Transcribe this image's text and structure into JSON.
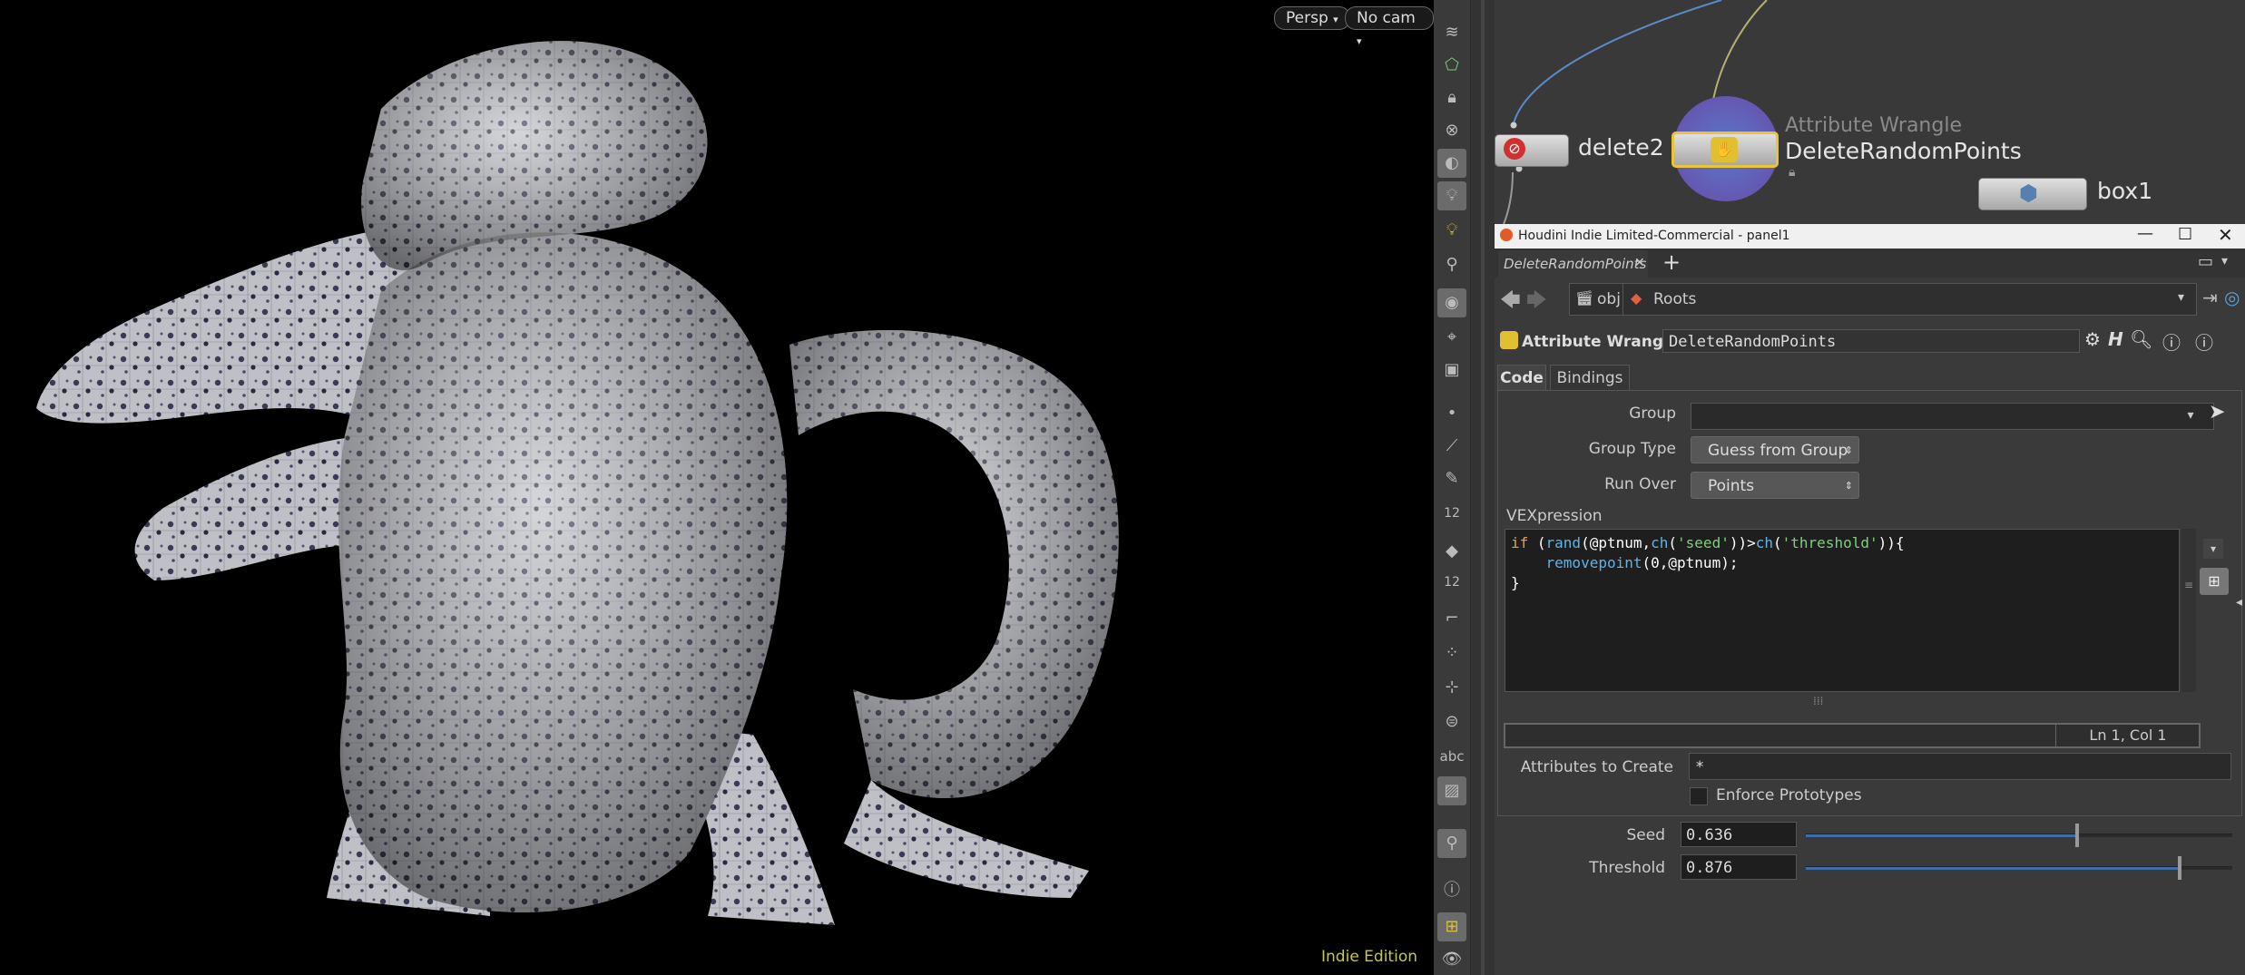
{
  "viewport": {
    "persp_label": "Persp",
    "cam_label": "No cam",
    "watermark": "Indie Edition"
  },
  "toolbar": {
    "label_12a": "12",
    "label_12b": "12",
    "label_abc": "abc"
  },
  "network": {
    "nodes": [
      {
        "name": "delete2"
      },
      {
        "type": "Attribute Wrangle",
        "name": "DeleteRandomPoints"
      },
      {
        "name": "box1"
      }
    ]
  },
  "window": {
    "title": "Houdini Indie Limited-Commercial - panel1"
  },
  "panel": {
    "tab_label": "DeleteRandomPoints",
    "path": {
      "obj": "obj",
      "roots": "Roots"
    },
    "node_type": "Attribute Wrangle",
    "node_name": "DeleteRandomPoints",
    "tabs": [
      {
        "label": "Code"
      },
      {
        "label": "Bindings"
      }
    ],
    "group_label": "Group",
    "group_value": "",
    "group_type_label": "Group Type",
    "group_type_value": "Guess from Group",
    "run_over_label": "Run Over",
    "run_over_value": "Points",
    "vex_label": "VEXpression",
    "code": {
      "line1_if": "if",
      "line1_a": " (",
      "line1_rand": "rand",
      "line1_b": "(@ptnum,",
      "line1_ch1": "ch",
      "line1_c": "(",
      "line1_seed": "'seed'",
      "line1_d": "))>",
      "line1_ch2": "ch",
      "line1_e": "(",
      "line1_threshold": "'threshold'",
      "line1_f": ")){",
      "line2_indent": "    ",
      "line2_fn": "removepoint",
      "line2_rest": "(0,@ptnum);",
      "line3": "}"
    },
    "cursor_pos": "Ln 1, Col 1",
    "attrs_label": "Attributes to Create",
    "attrs_value": "*",
    "enforce_label": "Enforce Prototypes",
    "enforce_checked": false,
    "seed_label": "Seed",
    "seed_value": "0.636",
    "seed_fraction": 0.636,
    "threshold_label": "Threshold",
    "threshold_value": "0.876",
    "threshold_fraction": 0.876
  },
  "colors": {
    "accent_blue": "#3d6ea6",
    "watermark": "#c8c840",
    "node_selected": "#e8c43a"
  }
}
